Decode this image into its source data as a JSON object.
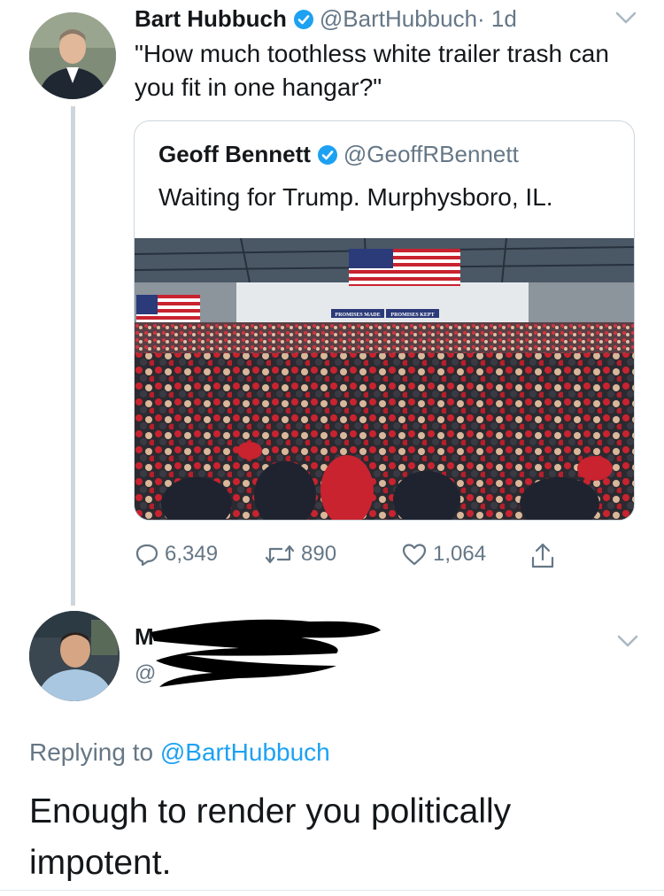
{
  "tweet": {
    "author_name": "Bart Hubbuch",
    "author_handle": "@BartHubbuch",
    "time": "· 1d",
    "text": "\"How much toothless white trailer trash can you fit in one hangar?\"",
    "verified": true
  },
  "quoted": {
    "author_name": "Geoff Bennett",
    "author_handle": "@GeoffRBennett",
    "text": "Waiting for Trump. Murphysboro, IL.",
    "verified": true,
    "image": {
      "banner_left": "PROMISES MADE",
      "banner_right": "PROMISES KEPT"
    }
  },
  "actions": {
    "replies": "6,349",
    "retweets": "890",
    "likes": "1,064"
  },
  "reply": {
    "name_fragment": "M",
    "handle_fragment": "@",
    "replying_prefix": "Replying to",
    "replying_to": "@BartHubbuch",
    "text": "Enough to render you politically impotent."
  },
  "colors": {
    "text": "#14171a",
    "muted": "#657786",
    "link": "#1da1f2",
    "verified": "#1da1f2",
    "border": "#ccd6dd"
  }
}
